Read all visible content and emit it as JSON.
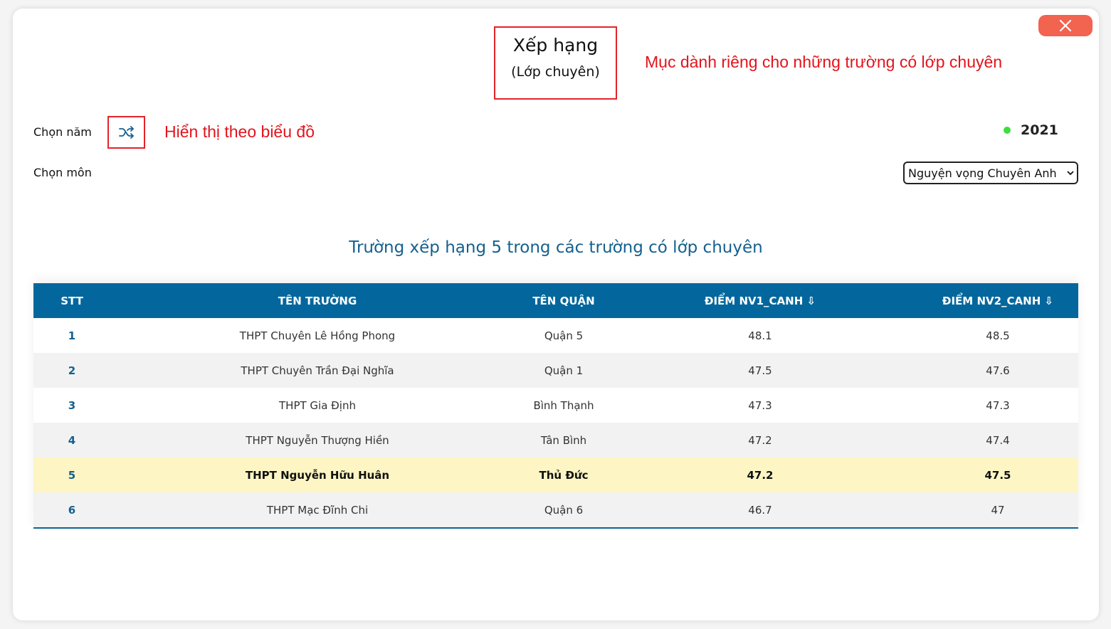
{
  "header": {
    "title": "Xếp hạng",
    "subtitle": "(Lớp chuyên)",
    "note": "Mục dành riêng cho những trường có lớp chuyên"
  },
  "controls": {
    "year_label": "Chọn năm",
    "chart_note": "Hiển thị theo biểu đồ",
    "year": "2021",
    "subject_label": "Chọn môn",
    "subject_selected": "Nguyện vọng Chuyên Anh"
  },
  "table": {
    "title": "Trường xếp hạng 5 trong các trường có lớp chuyên",
    "columns": [
      "STT",
      "TÊN TRƯỜNG",
      "TÊN QUẬN",
      "ĐIỂM NV1_CANH ⇩",
      "ĐIỂM NV2_CANH ⇩"
    ],
    "rows": [
      {
        "stt": "1",
        "school": "THPT Chuyên Lê Hồng Phong",
        "district": "Quận 5",
        "nv1": "48.1",
        "nv2": "48.5"
      },
      {
        "stt": "2",
        "school": "THPT Chuyên Trần Đại Nghĩa",
        "district": "Quận 1",
        "nv1": "47.5",
        "nv2": "47.6"
      },
      {
        "stt": "3",
        "school": "THPT Gia Định",
        "district": "Bình Thạnh",
        "nv1": "47.3",
        "nv2": "47.3"
      },
      {
        "stt": "4",
        "school": "THPT Nguyễn Thượng Hiền",
        "district": "Tân Bình",
        "nv1": "47.2",
        "nv2": "47.4"
      },
      {
        "stt": "5",
        "school": "THPT Nguyễn Hữu Huân",
        "district": "Thủ Đức",
        "nv1": "47.2",
        "nv2": "47.5"
      },
      {
        "stt": "6",
        "school": "THPT Mạc Đĩnh Chi",
        "district": "Quận 6",
        "nv1": "46.7",
        "nv2": "47"
      }
    ]
  },
  "colors": {
    "header_bg": "#03679d",
    "accent_red": "#e3141c",
    "highlight_row": "#fdf6c4",
    "close_button": "#f26350",
    "status_dot": "#3be03b"
  },
  "icons": {
    "close": "close-icon",
    "shuffle": "shuffle-icon",
    "chevron": "chevron-down-icon"
  }
}
